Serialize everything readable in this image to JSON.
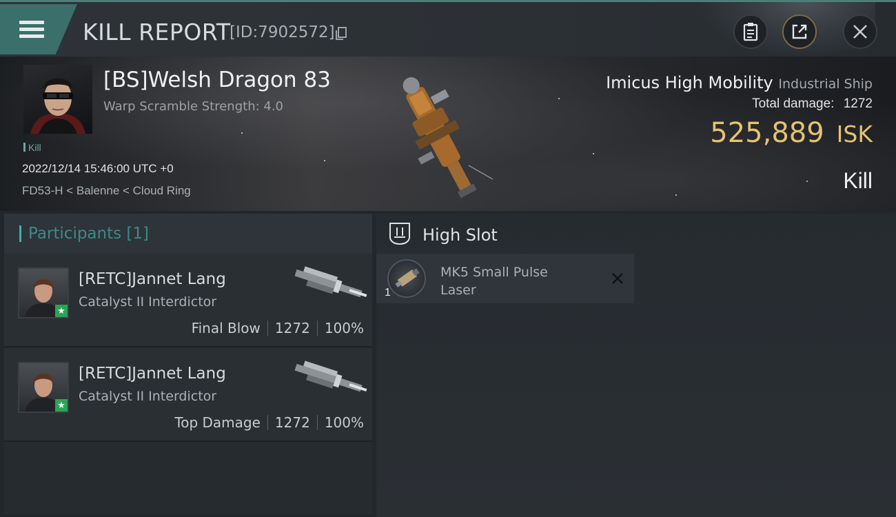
{
  "header": {
    "title": "KILL REPORT",
    "report_id": "[ID:7902572]"
  },
  "victim": {
    "name": "[BS]Welsh Dragon 83",
    "warp_scramble": "Warp Scramble Strength: 4.0",
    "tag": "Kill",
    "datetime": "2022/12/14 15:46:00 UTC +0",
    "location": "FD53-H < Balenne < Cloud Ring",
    "ship_name": "Imicus High Mobility",
    "ship_class": "Industrial Ship",
    "total_damage_label": "Total damage:",
    "total_damage": "1272",
    "isk_value": "525,889",
    "isk_unit": "ISK",
    "result": "Kill"
  },
  "participants": {
    "header": "Participants [1]",
    "rows": [
      {
        "name": "[RETC]Jannet Lang",
        "ship": "Catalyst II Interdictor",
        "role": "Final Blow",
        "damage": "1272",
        "percent": "100%"
      },
      {
        "name": "[RETC]Jannet Lang",
        "ship": "Catalyst II Interdictor",
        "role": "Top Damage",
        "damage": "1272",
        "percent": "100%"
      }
    ]
  },
  "fitting": {
    "slot_title": "High Slot",
    "modules": [
      {
        "quantity": "1",
        "name": "MK5 Small Pulse Laser"
      }
    ]
  },
  "colors": {
    "accent": "#3b6f6b",
    "isk": "#e5c272",
    "badge": "#2aa556"
  },
  "icons": [
    "menu-icon",
    "copy-icon",
    "clipboard-icon",
    "share-icon",
    "close-icon",
    "high-slot-icon",
    "destroyed-x-icon",
    "star-badge-icon"
  ]
}
